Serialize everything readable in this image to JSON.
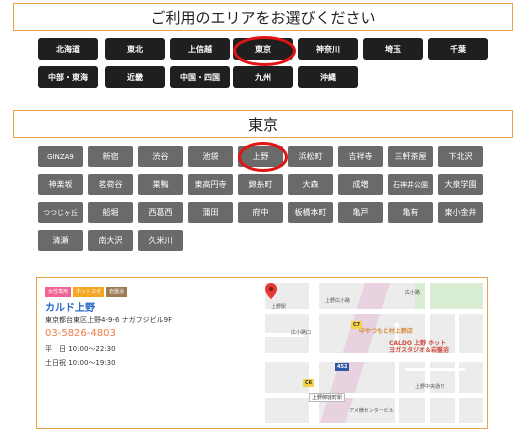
{
  "area_section": {
    "title": "ご利用のエリアをお選びください",
    "regions": [
      "北海道",
      "東北",
      "上信越",
      "東京",
      "神奈川",
      "埼玉",
      "千葉",
      "中部・東海",
      "近畿",
      "中国・四国",
      "九州",
      "沖縄"
    ],
    "selected": "東京"
  },
  "tokyo_section": {
    "title": "東京",
    "cities": [
      "GINZA9",
      "新宿",
      "渋谷",
      "池袋",
      "上野",
      "浜松町",
      "吉祥寺",
      "三軒茶屋",
      "下北沢",
      "神楽坂",
      "茗荷谷",
      "巣鴨",
      "東高円寺",
      "錦糸町",
      "大森",
      "成増",
      "石神井公園",
      "大泉学園",
      "つつじヶ丘",
      "船堀",
      "西葛西",
      "蒲田",
      "府中",
      "板橋本町",
      "亀戸",
      "亀有",
      "東小金井",
      "清瀬",
      "南大沢",
      "久米川"
    ],
    "selected": "上野"
  },
  "store": {
    "badges": [
      "女性専用",
      "ホットヨガ",
      "岩盤浴"
    ],
    "name": "カルド上野",
    "address": "東京都台東区上野4-9-6 ナガフジビル9F",
    "phone": "03-5826-4803",
    "hours_weekday": "平　日 10:00～22:30",
    "hours_weekend": "土日祝 10:00～19:30"
  },
  "map": {
    "labels": [
      "上野広小路",
      "広小路口",
      "上野駅",
      "アメ横センタービル",
      "広小路",
      "上野中央通り"
    ],
    "poi_lines": [
      "CALDO 上野 ホット",
      "ヨガスタジオ＆岩盤浴"
    ],
    "poi_secondary": "中やつもと村上野店",
    "road_signs": [
      "C7",
      "C6",
      "452"
    ],
    "station": "上野御徒町駅",
    "colors": {
      "road": "#ffffff",
      "rail": "#e8d2e0",
      "pin": "#e53935",
      "park": "#d7ecd2"
    }
  },
  "colors": {
    "region_bg": "#1f1f1f",
    "city_bg": "#6a6a6a",
    "border_accent": "#e8a24a",
    "highlight_circle": "#e11414"
  }
}
